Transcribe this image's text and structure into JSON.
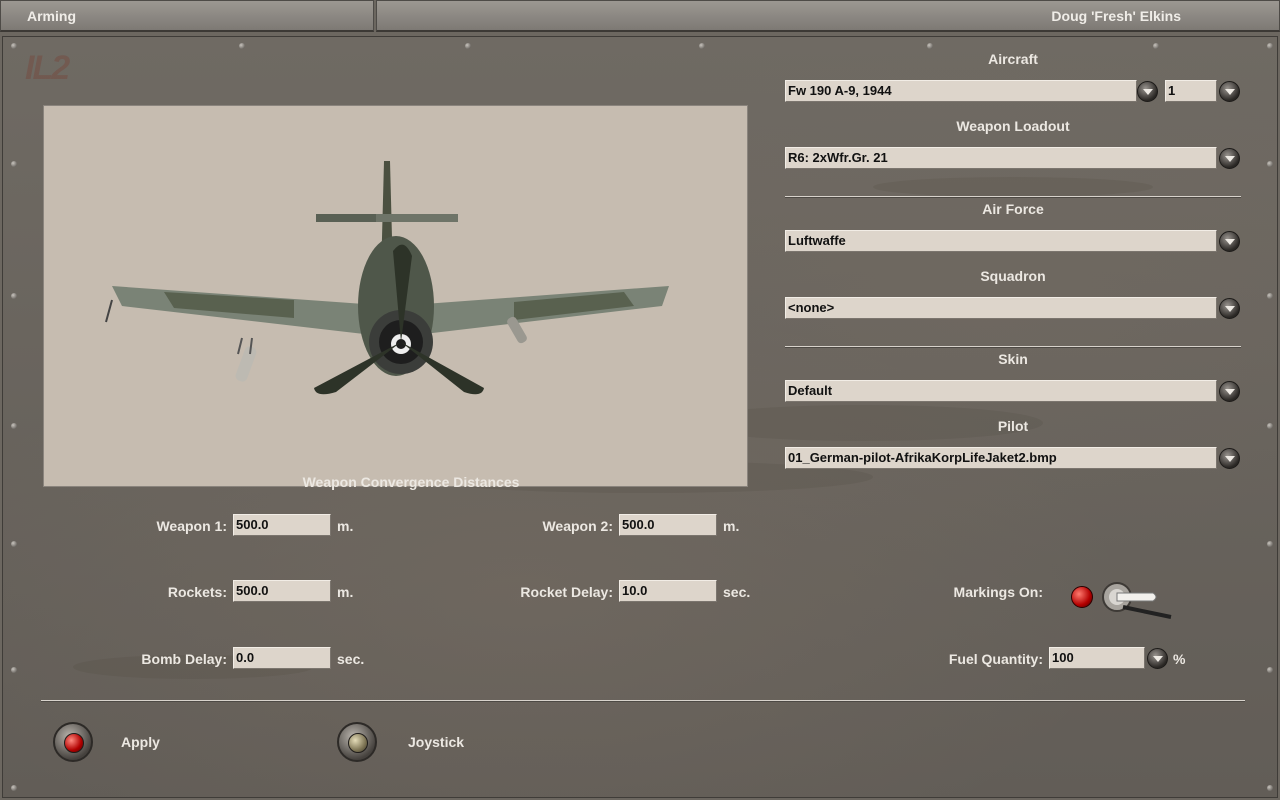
{
  "titlebar": {
    "left": "Arming",
    "right": "Doug 'Fresh' Elkins"
  },
  "logo": "IL2",
  "aircraft": {
    "label": "Aircraft",
    "model": "Fw 190 A-9, 1944",
    "count": "1"
  },
  "loadout": {
    "label": "Weapon Loadout",
    "value": "R6: 2xWfr.Gr. 21"
  },
  "air_force": {
    "label": "Air Force",
    "value": "Luftwaffe"
  },
  "squadron": {
    "label": "Squadron",
    "value": "<none>"
  },
  "skin": {
    "label": "Skin",
    "value": "Default"
  },
  "pilot": {
    "label": "Pilot",
    "value": "01_German-pilot-AfrikaKorpLifeJaket2.bmp"
  },
  "convergence": {
    "title": "Weapon Convergence Distances",
    "weapon1": {
      "label": "Weapon 1:",
      "value": "500.0",
      "unit": "m."
    },
    "weapon2": {
      "label": "Weapon 2:",
      "value": "500.0",
      "unit": "m."
    },
    "rockets": {
      "label": "Rockets:",
      "value": "500.0",
      "unit": "m."
    },
    "rocket_delay": {
      "label": "Rocket Delay:",
      "value": "10.0",
      "unit": "sec."
    },
    "bomb_delay": {
      "label": "Bomb Delay:",
      "value": "0.0",
      "unit": "sec."
    }
  },
  "markings": {
    "label": "Markings On:"
  },
  "fuel": {
    "label": "Fuel Quantity:",
    "value": "100",
    "unit": "%"
  },
  "buttons": {
    "apply": "Apply",
    "joystick": "Joystick"
  },
  "colors": {
    "accent_red": "#c40000",
    "field_bg": "#ddd5cb",
    "panel": "#6c6760"
  },
  "icons": [
    "dropdown-arrow-icon",
    "red-led-icon",
    "toggle-switch-icon",
    "aircraft-preview"
  ]
}
